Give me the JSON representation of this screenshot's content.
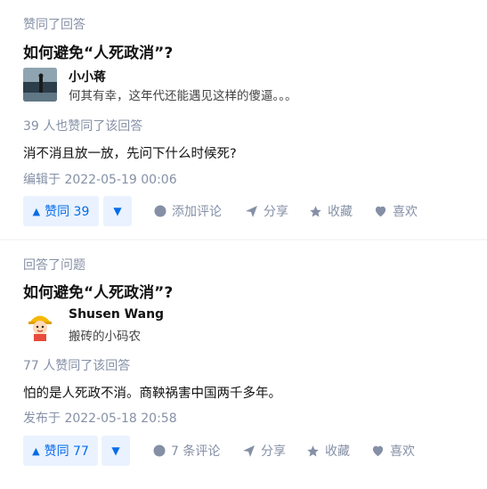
{
  "feed": [
    {
      "activity": "赞同了回答",
      "question": "如何避免“人死政消”?",
      "author": {
        "name": "小小蒋",
        "bio": "何其有幸，这年代还能遇见这样的傻逼。。。"
      },
      "upvote_summary": "39 人也赞同了该回答",
      "content": "消不消且放一放，先问下什么时候死?",
      "timestamp": "编辑于 2022-05-19 00:06",
      "actions": {
        "vote": "赞同 39",
        "comment": "添加评论",
        "share": "分享",
        "favorite": "收藏",
        "like": "喜欢"
      }
    },
    {
      "activity": "回答了问题",
      "question": "如何避免“人死政消”?",
      "author": {
        "name": "Shusen Wang",
        "bio": "搬砖的小码农"
      },
      "upvote_summary": "77 人赞同了该回答",
      "content": "怕的是人死政不消。商鞅祸害中国两千多年。",
      "timestamp": "发布于 2022-05-18 20:58",
      "actions": {
        "vote": "赞同 77",
        "comment": "7 条评论",
        "share": "分享",
        "favorite": "收藏",
        "like": "喜欢"
      }
    }
  ],
  "colors": {
    "accent": "#056de8",
    "accent_bg": "#eaf2ff",
    "meta": "#8590a6"
  },
  "icons": [
    "upvote-triangle-icon",
    "downvote-triangle-icon",
    "comment-icon",
    "share-icon",
    "star-icon",
    "heart-icon"
  ]
}
